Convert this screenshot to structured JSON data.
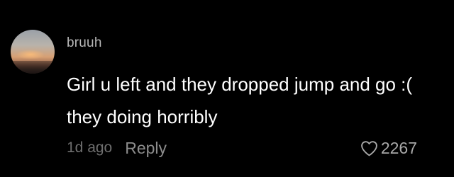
{
  "comment": {
    "username": "bruuh",
    "text": "Girl u left and they dropped jump and go :( they doing horribly",
    "time": "1d ago",
    "reply_label": "Reply",
    "like_count": "2267",
    "like_icon": "heart-outline-icon"
  },
  "colors": {
    "background": "#000000",
    "text": "#ffffff",
    "username": "#b8b8b8",
    "meta": "#6e6e6e"
  }
}
